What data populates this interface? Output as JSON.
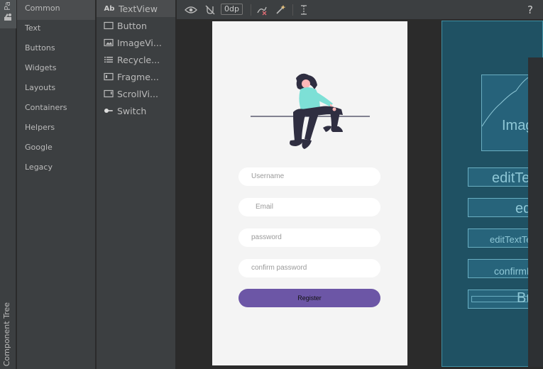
{
  "side_tabs": {
    "palette": "Pa",
    "component_tree": "Component Tree"
  },
  "categories": [
    {
      "label": "Common",
      "selected": true
    },
    {
      "label": "Text",
      "selected": false
    },
    {
      "label": "Buttons",
      "selected": false
    },
    {
      "label": "Widgets",
      "selected": false
    },
    {
      "label": "Layouts",
      "selected": false
    },
    {
      "label": "Containers",
      "selected": false
    },
    {
      "label": "Helpers",
      "selected": false
    },
    {
      "label": "Google",
      "selected": false
    },
    {
      "label": "Legacy",
      "selected": false
    }
  ],
  "components": [
    {
      "label": "TextView",
      "icon": "textview-icon",
      "glyph": "Ab",
      "selected": true
    },
    {
      "label": "Button",
      "icon": "button-icon",
      "selected": false
    },
    {
      "label": "ImageVi...",
      "icon": "imageview-icon",
      "selected": false
    },
    {
      "label": "Recycle...",
      "icon": "list-icon",
      "selected": false
    },
    {
      "label": "Fragme...",
      "icon": "fragment-icon",
      "selected": false
    },
    {
      "label": "ScrollVi...",
      "icon": "scrollview-icon",
      "selected": false
    },
    {
      "label": "Switch",
      "icon": "switch-icon",
      "selected": false
    }
  ],
  "toolbar": {
    "margin_value": "0dp",
    "help": "?"
  },
  "design": {
    "fields": [
      {
        "placeholder": "Username"
      },
      {
        "placeholder": "Email"
      },
      {
        "placeholder": "password"
      },
      {
        "placeholder": "confirm password"
      }
    ],
    "register_label": "Register",
    "accent": "#6c56a6"
  },
  "blueprint": {
    "image_label": "Image",
    "boxes": [
      "editTex",
      "edit",
      "editTextTex",
      "confirmPa",
      "Butt"
    ]
  }
}
